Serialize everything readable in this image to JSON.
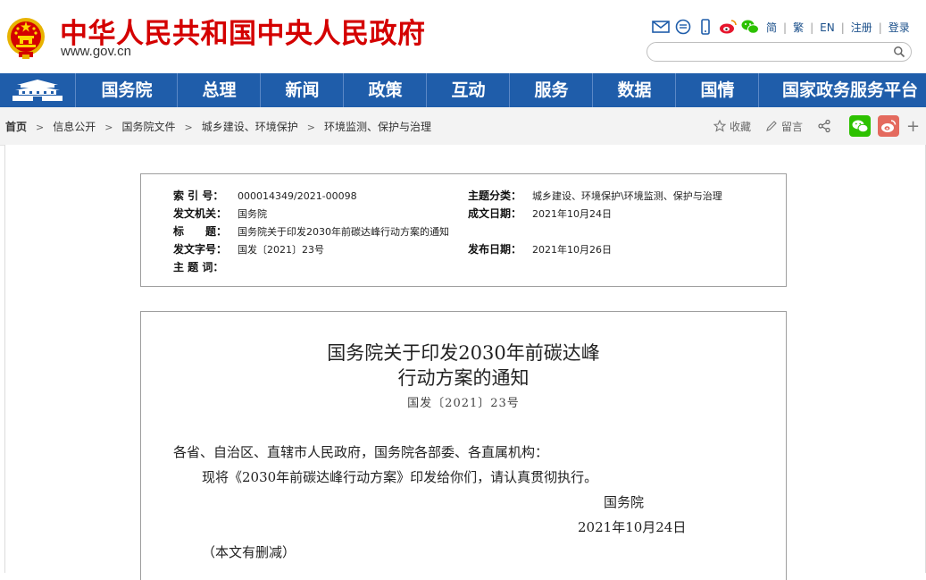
{
  "header": {
    "site_title": "中华人民共和国中央人民政府",
    "site_url": "www.gov.cn",
    "top_links": [
      "简",
      "繁",
      "EN",
      "注册",
      "登录"
    ],
    "search_placeholder": ""
  },
  "nav": {
    "items": [
      "国务院",
      "总理",
      "新闻",
      "政策",
      "互动",
      "服务",
      "数据",
      "国情",
      "国家政务服务平台"
    ]
  },
  "breadcrumb": {
    "items": [
      "首页",
      "信息公开",
      "国务院文件",
      "城乡建设、环境保护",
      "环境监测、保护与治理"
    ]
  },
  "tools": {
    "collect": "收藏",
    "comment": "留言",
    "more": "+"
  },
  "meta": {
    "index_label": "索 引 号：",
    "index_value": "000014349/2021-00098",
    "topic_label": "主题分类：",
    "topic_value": "城乡建设、环境保护\\环境监测、保护与治理",
    "issuer_label": "发文机关：",
    "issuer_value": "国务院",
    "written_label": "成文日期：",
    "written_value": "2021年10月24日",
    "title_label": "标　　题：",
    "title_value": "国务院关于印发2030年前碳达峰行动方案的通知",
    "docno_label": "发文字号：",
    "docno_value": "国发〔2021〕23号",
    "published_label": "发布日期：",
    "published_value": "2021年10月26日",
    "keywords_label": "主 题 词：",
    "keywords_value": ""
  },
  "document": {
    "title_line1": "国务院关于印发2030年前碳达峰",
    "title_line2": "行动方案的通知",
    "doc_number": "国发〔2021〕23号",
    "addressee": "各省、自治区、直辖市人民政府，国务院各部委、各直属机构：",
    "body": "现将《2030年前碳达峰行动方案》印发给你们，请认真贯彻执行。",
    "signer": "国务院",
    "date": "2021年10月24日",
    "note": "（本文有删减）"
  },
  "colors": {
    "brand_red": "#d40000",
    "nav_blue": "#1f5daa",
    "wechat_green": "#2dc100",
    "weibo_red": "#e6162d"
  }
}
